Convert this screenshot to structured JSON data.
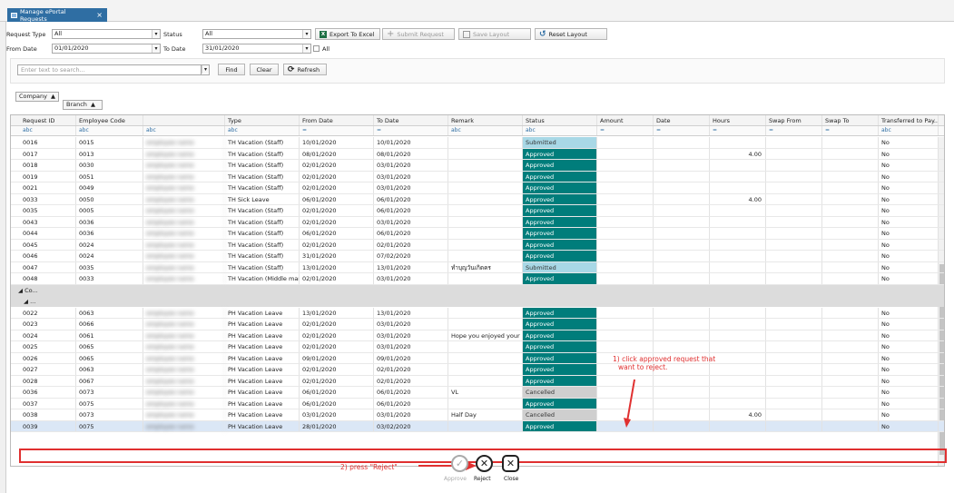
{
  "tab": {
    "title": "Manage ePortal Requests"
  },
  "toolbar": {
    "request_type_label": "Request Type",
    "request_type_value": "All",
    "status_label": "Status",
    "status_value": "All",
    "from_date_label": "From Date",
    "from_date_value": "01/01/2020",
    "to_date_label": "To Date",
    "to_date_value": "31/01/2020",
    "all_label": "All",
    "export_label": "Export To Excel",
    "submit_label": "Submit Request",
    "save_label": "Save Layout",
    "reset_label": "Reset Layout"
  },
  "search": {
    "placeholder": "Enter text to search...",
    "find": "Find",
    "clear": "Clear",
    "refresh": "Refresh"
  },
  "grouping": {
    "company": "Company",
    "branch": "Branch"
  },
  "columns": [
    "Request ID",
    "Employee Code",
    "",
    "Type",
    "From Date",
    "To Date",
    "Remark",
    "Status",
    "Amount",
    "Date",
    "Hours",
    "Swap From",
    "Swap To",
    "Transferred to Pay..."
  ],
  "rows_a": [
    {
      "id": "0016",
      "emp": "0015",
      "type": "TH Vacation (Staff)",
      "from": "10/01/2020",
      "to": "10/01/2020",
      "remark": "",
      "status": "Submitted",
      "hours": "",
      "tr": "No"
    },
    {
      "id": "0017",
      "emp": "0013",
      "type": "TH Vacation (Staff)",
      "from": "08/01/2020",
      "to": "08/01/2020",
      "remark": "",
      "status": "Approved",
      "hours": "4.00",
      "tr": "No"
    },
    {
      "id": "0018",
      "emp": "0030",
      "type": "TH Vacation (Staff)",
      "from": "02/01/2020",
      "to": "03/01/2020",
      "remark": "",
      "status": "Approved",
      "hours": "",
      "tr": "No"
    },
    {
      "id": "0019",
      "emp": "0051",
      "type": "TH Vacation (Staff)",
      "from": "02/01/2020",
      "to": "03/01/2020",
      "remark": "",
      "status": "Approved",
      "hours": "",
      "tr": "No"
    },
    {
      "id": "0021",
      "emp": "0049",
      "type": "TH Vacation (Staff)",
      "from": "02/01/2020",
      "to": "03/01/2020",
      "remark": "",
      "status": "Approved",
      "hours": "",
      "tr": "No"
    },
    {
      "id": "0033",
      "emp": "0050",
      "type": "TH Sick Leave",
      "from": "06/01/2020",
      "to": "06/01/2020",
      "remark": "",
      "status": "Approved",
      "hours": "4.00",
      "tr": "No"
    },
    {
      "id": "0035",
      "emp": "0005",
      "type": "TH Vacation (Staff)",
      "from": "02/01/2020",
      "to": "06/01/2020",
      "remark": "",
      "status": "Approved",
      "hours": "",
      "tr": "No"
    },
    {
      "id": "0043",
      "emp": "0036",
      "type": "TH Vacation (Staff)",
      "from": "02/01/2020",
      "to": "03/01/2020",
      "remark": "",
      "status": "Approved",
      "hours": "",
      "tr": "No"
    },
    {
      "id": "0044",
      "emp": "0036",
      "type": "TH Vacation (Staff)",
      "from": "06/01/2020",
      "to": "06/01/2020",
      "remark": "",
      "status": "Approved",
      "hours": "",
      "tr": "No"
    },
    {
      "id": "0045",
      "emp": "0024",
      "type": "TH Vacation (Staff)",
      "from": "02/01/2020",
      "to": "02/01/2020",
      "remark": "",
      "status": "Approved",
      "hours": "",
      "tr": "No"
    },
    {
      "id": "0046",
      "emp": "0024",
      "type": "TH Vacation (Staff)",
      "from": "31/01/2020",
      "to": "07/02/2020",
      "remark": "",
      "status": "Approved",
      "hours": "",
      "tr": "No"
    },
    {
      "id": "0047",
      "emp": "0035",
      "type": "TH Vacation (Staff)",
      "from": "13/01/2020",
      "to": "13/01/2020",
      "remark": "ทำบุญวันเกิดคร",
      "status": "Submitted",
      "hours": "",
      "tr": "No"
    },
    {
      "id": "0048",
      "emp": "0033",
      "type": "TH Vacation (Middle man...",
      "from": "02/01/2020",
      "to": "03/01/2020",
      "remark": "",
      "status": "Approved",
      "hours": "",
      "tr": "No"
    }
  ],
  "group_rows": [
    "Co...",
    "..."
  ],
  "rows_b": [
    {
      "id": "0022",
      "emp": "0063",
      "type": "PH Vacation Leave",
      "from": "13/01/2020",
      "to": "13/01/2020",
      "remark": "",
      "status": "Approved",
      "hours": "",
      "tr": "No"
    },
    {
      "id": "0023",
      "emp": "0066",
      "type": "PH Vacation Leave",
      "from": "02/01/2020",
      "to": "03/01/2020",
      "remark": "",
      "status": "Approved",
      "hours": "",
      "tr": "No"
    },
    {
      "id": "0024",
      "emp": "0061",
      "type": "PH Vacation Leave",
      "from": "02/01/2020",
      "to": "03/01/2020",
      "remark": "Hope you enjoyed your ...",
      "status": "Approved",
      "hours": "",
      "tr": "No"
    },
    {
      "id": "0025",
      "emp": "0065",
      "type": "PH Vacation Leave",
      "from": "02/01/2020",
      "to": "03/01/2020",
      "remark": "",
      "status": "Approved",
      "hours": "",
      "tr": "No"
    },
    {
      "id": "0026",
      "emp": "0065",
      "type": "PH Vacation Leave",
      "from": "09/01/2020",
      "to": "09/01/2020",
      "remark": "",
      "status": "Approved",
      "hours": "",
      "tr": "No"
    },
    {
      "id": "0027",
      "emp": "0063",
      "type": "PH Vacation Leave",
      "from": "02/01/2020",
      "to": "02/01/2020",
      "remark": "",
      "status": "Approved",
      "hours": "",
      "tr": "No"
    },
    {
      "id": "0028",
      "emp": "0067",
      "type": "PH Vacation Leave",
      "from": "02/01/2020",
      "to": "02/01/2020",
      "remark": "",
      "status": "Approved",
      "hours": "",
      "tr": "No"
    },
    {
      "id": "0036",
      "emp": "0073",
      "type": "PH Vacation Leave",
      "from": "06/01/2020",
      "to": "06/01/2020",
      "remark": "VL",
      "status": "Cancelled",
      "hours": "",
      "tr": "No"
    },
    {
      "id": "0037",
      "emp": "0075",
      "type": "PH Vacation Leave",
      "from": "06/01/2020",
      "to": "06/01/2020",
      "remark": "",
      "status": "Approved",
      "hours": "",
      "tr": "No"
    },
    {
      "id": "0038",
      "emp": "0073",
      "type": "PH Vacation Leave",
      "from": "03/01/2020",
      "to": "03/01/2020",
      "remark": "Half Day",
      "status": "Cancelled",
      "hours": "4.00",
      "tr": "No"
    },
    {
      "id": "0039",
      "emp": "0075",
      "type": "PH Vacation Leave",
      "from": "28/01/2020",
      "to": "03/02/2020",
      "remark": "",
      "status": "Approved",
      "hours": "",
      "tr": "No"
    }
  ],
  "annotations": {
    "step1_line1": "1) click approved request that",
    "step1_line2": "want to reject.",
    "step2": "2) press \"Reject\""
  },
  "actions": {
    "approve": "Approve",
    "reject": "Reject",
    "close": "Close"
  },
  "colors": {
    "approved": "#007d7b",
    "submitted": "#a8d8e6",
    "cancelled": "#cfcfcf",
    "annotation": "#e03030",
    "tab": "#2f6ea3"
  }
}
